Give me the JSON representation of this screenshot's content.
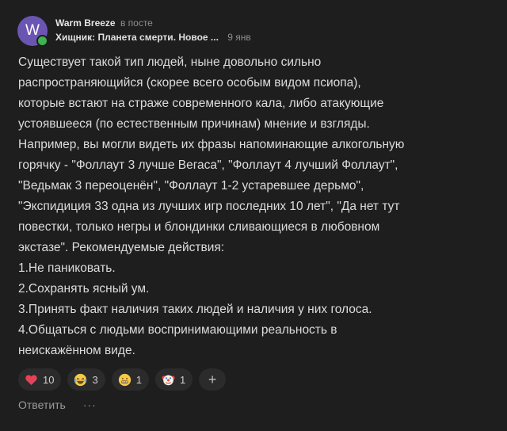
{
  "author": {
    "avatar_letter": "W",
    "name": "Warm Breeze",
    "in_post": "в посте"
  },
  "post": {
    "title": "Хищник: Планета смерти. Новое ...",
    "date": "9 янв"
  },
  "comment_lines": [
    "Существует такой тип людей, ныне довольно сильно",
    "распространяющийся (скорее всего особым видом псиопа),",
    "которые встают на страже современного кала, либо атакующие",
    "устоявшееся (по естественным причинам) мнение и взгляды.",
    "Например, вы могли видеть их фразы напоминающие алкогольную",
    "горячку - \"Фоллаут 3 лучше Вегаса\", \"Фоллаут 4 лучший Фоллаут\",",
    "\"Ведьмак 3 переоценён\", \"Фоллаут 1-2 устаревшее дерьмо\",",
    "\"Экспидиция 33 одна из лучших игр последних 10 лет\", \"Да нет тут",
    "повестки, только негры и блондинки сливающиеся в любовном",
    "экстазе\". Рекомендуемые действия:",
    "1.Не паниковать.",
    "2.Сохранять ясный ум.",
    "3.Принять факт наличия таких людей и наличия у них голоса.",
    "4.Общаться с людьми воспринимающими реальность в",
    "неискажённом виде."
  ],
  "reactions": [
    {
      "icon": "heart-icon",
      "count": "10"
    },
    {
      "icon": "laughing-tears-emoji-icon",
      "count": "3"
    },
    {
      "icon": "grimace-emoji-icon",
      "count": "1"
    },
    {
      "icon": "clown-emoji-icon",
      "count": "1"
    }
  ],
  "add_reaction_label": "+",
  "reply_label": "Ответить",
  "more_label": "···",
  "colors": {
    "avatar": "#6b55b3",
    "online": "#3fb34f",
    "heart": "#e5425a",
    "background": "#1e1e1e"
  }
}
